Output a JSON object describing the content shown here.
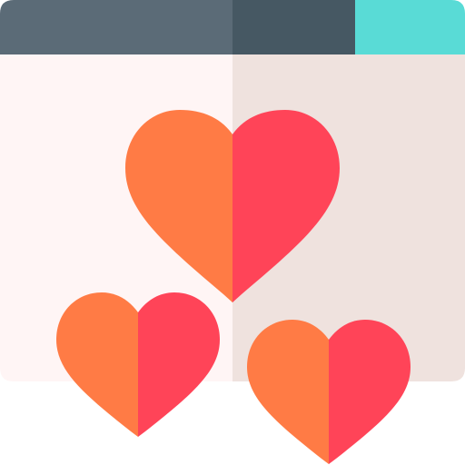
{
  "icon": {
    "name": "browser-window-hearts-icon",
    "colors": {
      "titlebar_left": "#5b6b77",
      "titlebar_right": "#465863",
      "titlebar_accent": "#59dbd6",
      "page_left": "#fff5f5",
      "page_right": "#efe2de",
      "heart_left": "#ff7b45",
      "heart_right": "#ff4458"
    },
    "hearts": [
      {
        "name": "large-heart"
      },
      {
        "name": "bottom-left-heart"
      },
      {
        "name": "bottom-right-heart"
      }
    ]
  }
}
